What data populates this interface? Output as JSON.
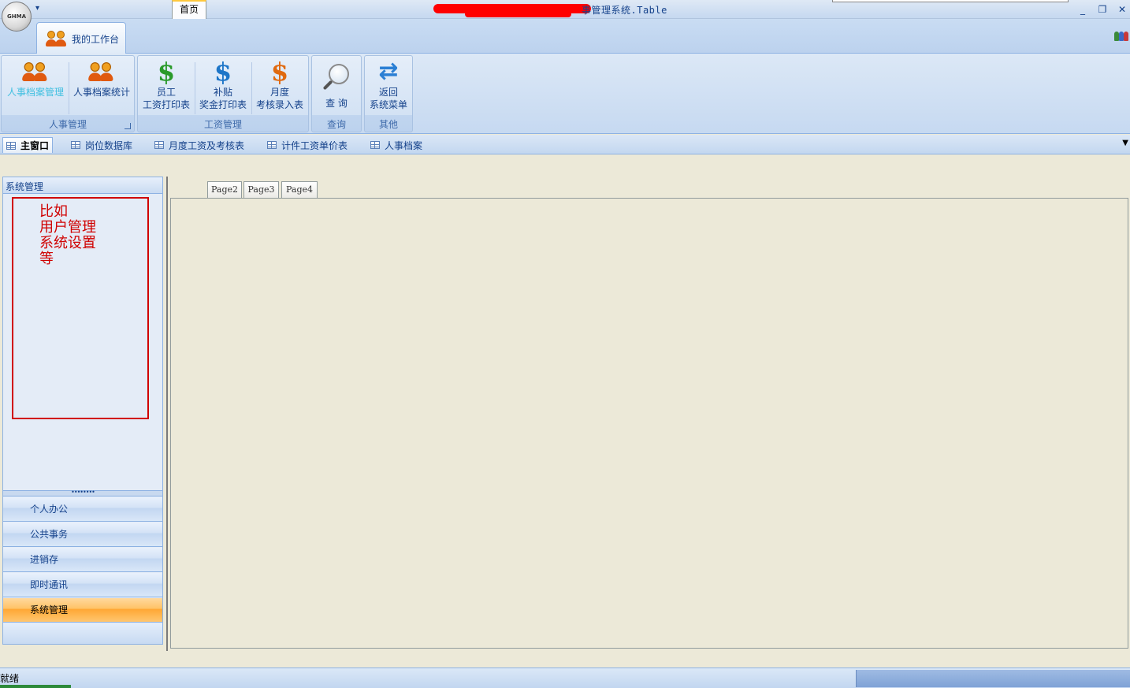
{
  "window": {
    "title": "事管理系统.Table",
    "logo_text": "GHMA",
    "qat_arrow": "▾",
    "minimize": "_",
    "maximize": "❐",
    "close": "✕"
  },
  "ribbon": {
    "tab_label": "我的工作台",
    "groups": [
      {
        "label": "人事管理",
        "buttons": [
          {
            "label": "人事档案管理",
            "icon": "people-icon",
            "active": true
          },
          {
            "label": "人事档案统计",
            "icon": "people-icon"
          }
        ]
      },
      {
        "label": "工资管理",
        "buttons": [
          {
            "line1": "员工",
            "line2": "工资打印表",
            "icon": "dollar-icon"
          },
          {
            "line1": "补贴",
            "line2": "奖金打印表",
            "icon": "dollar-icon"
          },
          {
            "line1": "月度",
            "line2": "考核录入表",
            "icon": "dollar-icon"
          }
        ]
      },
      {
        "label": "查询",
        "buttons": [
          {
            "label": "查 询",
            "icon": "magnifier-icon"
          }
        ]
      },
      {
        "label": "其他",
        "buttons": [
          {
            "line1": "返回",
            "line2": "系统菜单",
            "icon": "refresh-icon"
          }
        ]
      }
    ]
  },
  "doc_tabs": [
    "主窗口",
    "岗位数据库",
    "月度工资及考核表",
    "计件工资单价表",
    "人事档案"
  ],
  "doc_tabs_dropdown": "▼",
  "left_nav": {
    "header": "系统管理",
    "annotation": "比如\n用户管理\n系统设置\n等",
    "splitter": "••••••••",
    "items": [
      "个人办公",
      "公共事务",
      "进销存",
      "即时通讯",
      "系统管理"
    ],
    "selected": "系统管理"
  },
  "content_tabs": [
    "首页",
    "Page2",
    "Page3",
    "Page4"
  ],
  "status": {
    "text": "就绪"
  },
  "colors": {
    "accent_blue": "#15428b",
    "selected_orange": "#ffa733",
    "annotation_red": "#d00000"
  }
}
